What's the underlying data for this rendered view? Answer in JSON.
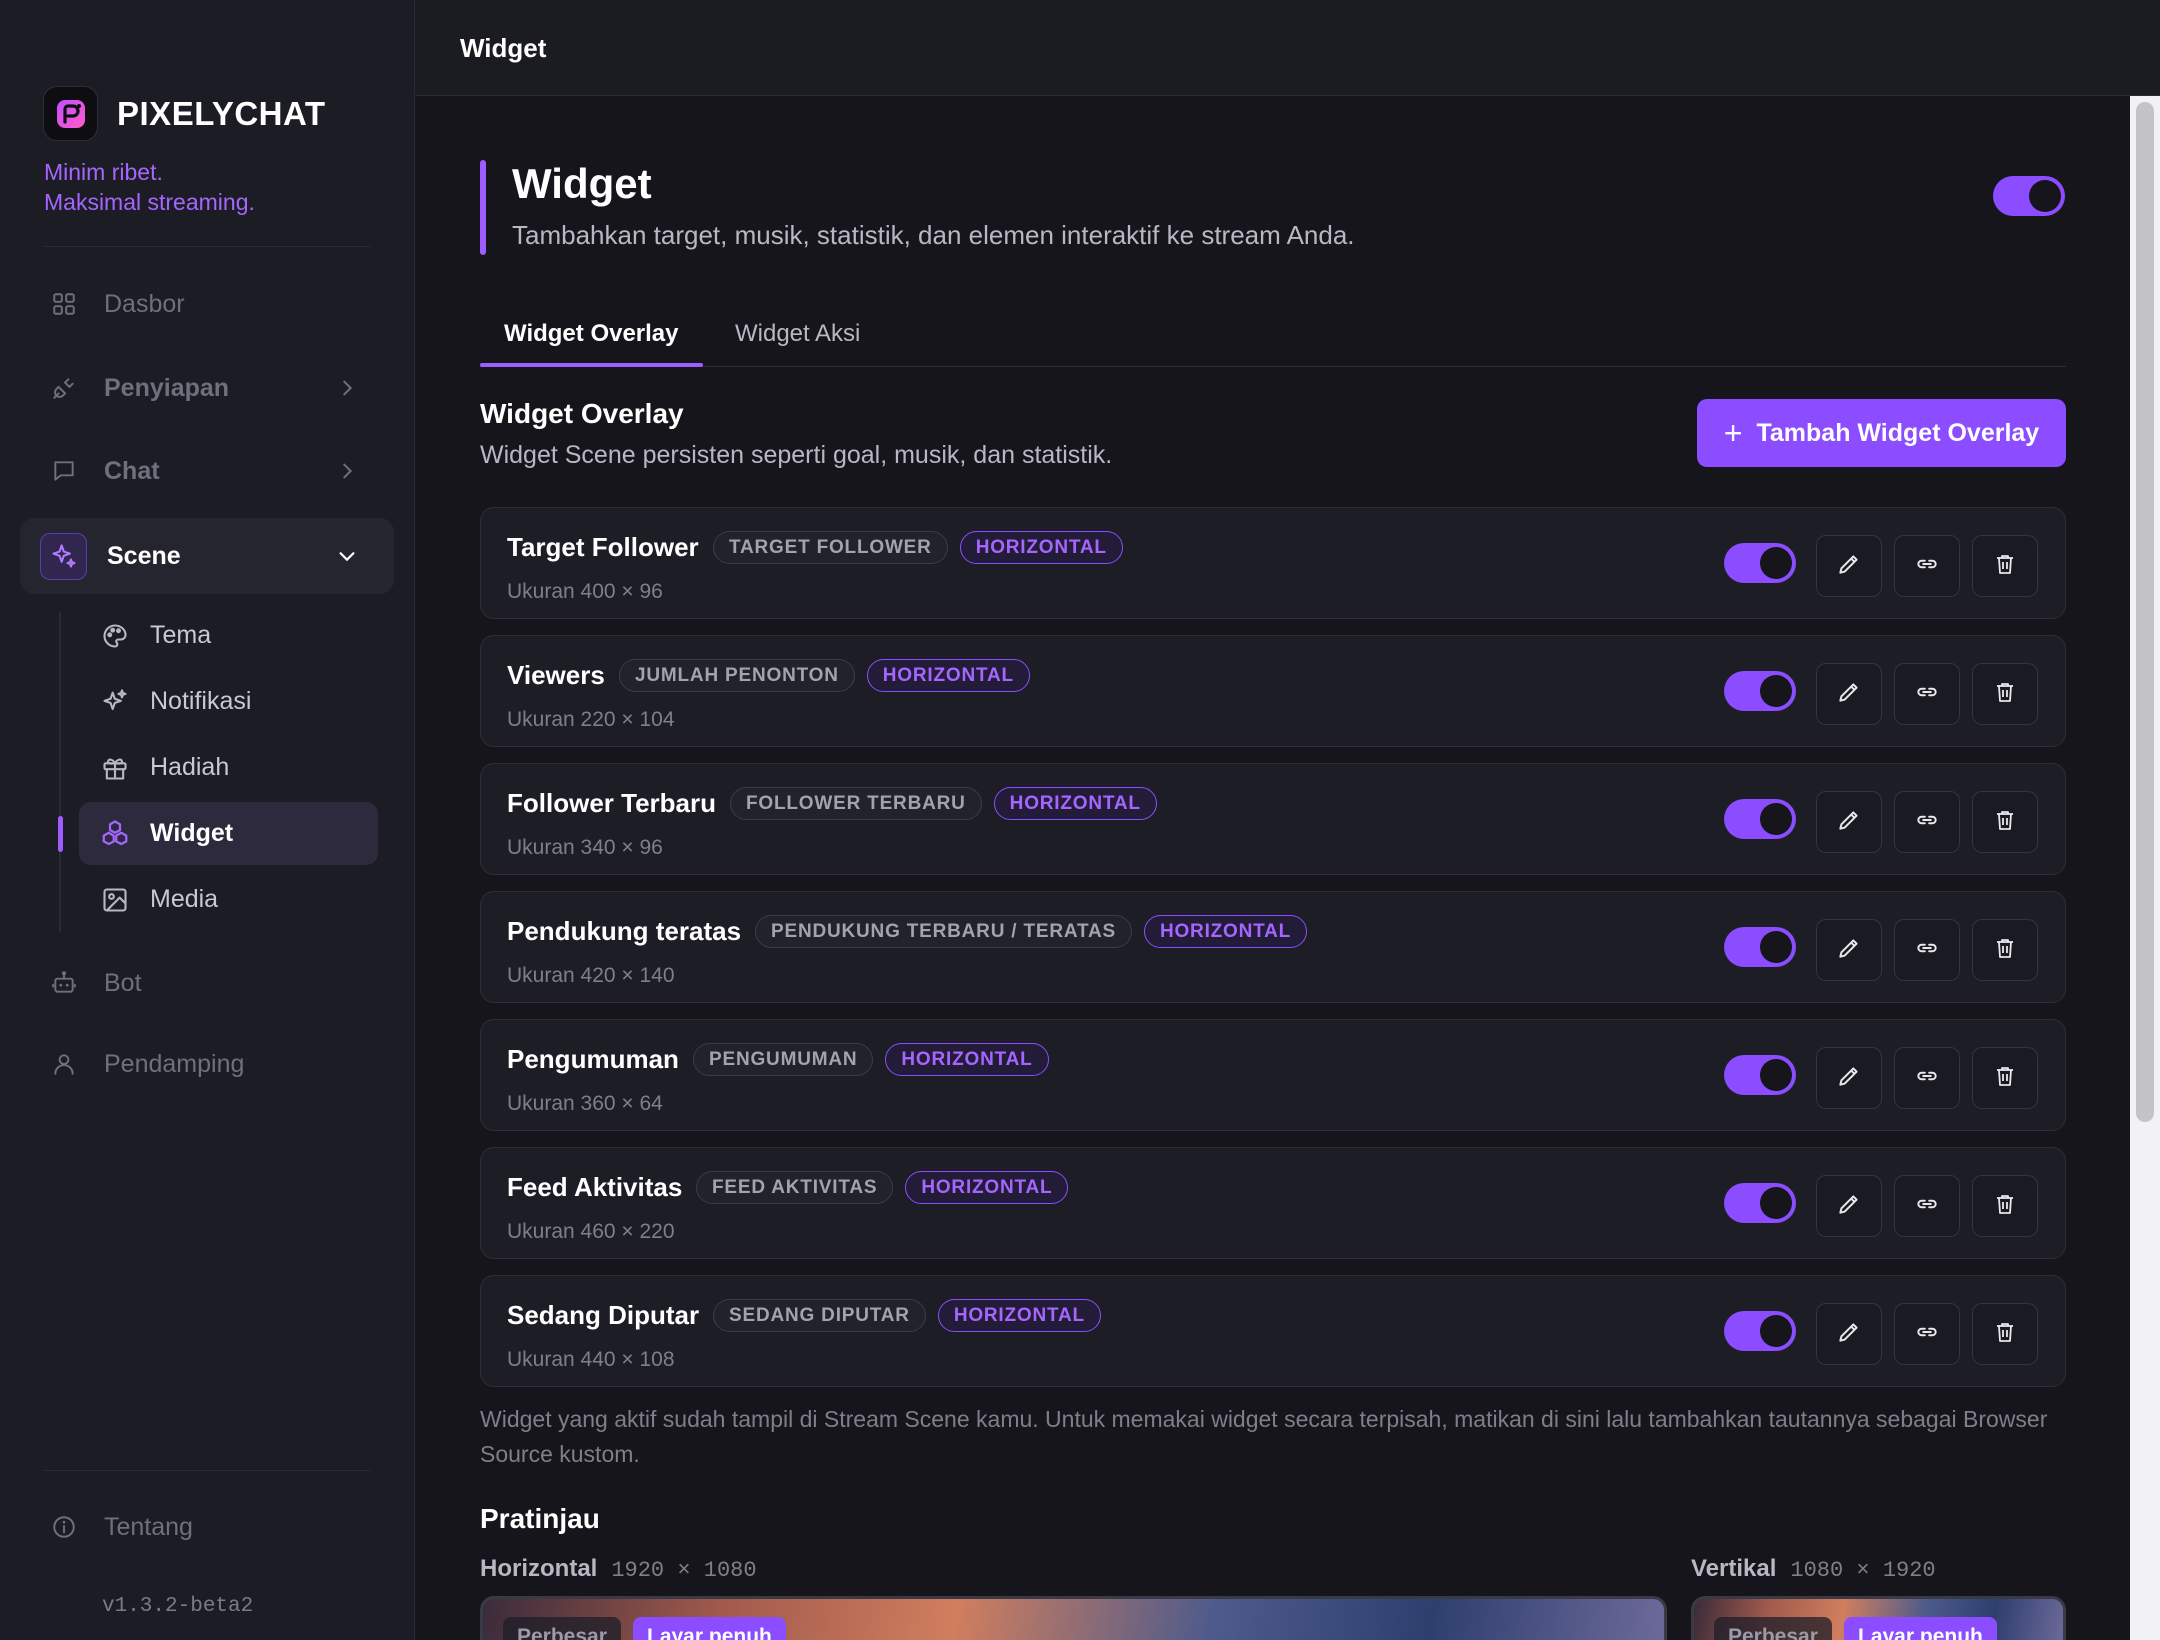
{
  "app": {
    "name": "PIXELYCHAT",
    "tagline_line1": "Minim ribet.",
    "tagline_line2": "Maksimal streaming.",
    "version": "v1.3.2-beta2"
  },
  "sidebar": {
    "nav": [
      {
        "label": "Dasbor",
        "icon": "grid-icon"
      },
      {
        "label": "Penyiapan",
        "icon": "plug-icon"
      },
      {
        "label": "Chat",
        "icon": "chat-bubble-icon"
      },
      {
        "label": "Scene",
        "icon": "sparkles-icon"
      },
      {
        "label": "Bot",
        "icon": "bot-icon"
      },
      {
        "label": "Pendamping",
        "icon": "user-icon"
      }
    ],
    "scene_children": [
      {
        "label": "Tema",
        "icon": "palette-icon"
      },
      {
        "label": "Notifikasi",
        "icon": "sparkles-icon"
      },
      {
        "label": "Hadiah",
        "icon": "gift-icon"
      },
      {
        "label": "Widget",
        "icon": "widget-cubes-icon"
      },
      {
        "label": "Media",
        "icon": "image-icon"
      }
    ],
    "about": {
      "label": "Tentang",
      "icon": "info-icon"
    }
  },
  "topbar": {
    "title": "Widget"
  },
  "page": {
    "title": "Widget",
    "subtitle": "Tambahkan target, musik, statistik, dan elemen interaktif ke stream Anda.",
    "enabled": true
  },
  "tabs": [
    {
      "label": "Widget Overlay",
      "active": true
    },
    {
      "label": "Widget Aksi",
      "active": false
    }
  ],
  "overlay": {
    "title": "Widget Overlay",
    "subtitle": "Widget Scene persisten seperti goal, musik, dan statistik.",
    "add_button": "Tambah Widget Overlay",
    "widgets": [
      {
        "name": "Target Follower",
        "type": "TARGET FOLLOWER",
        "orientation": "HORIZONTAL",
        "size": "Ukuran 400 × 96",
        "enabled": true
      },
      {
        "name": "Viewers",
        "type": "JUMLAH PENONTON",
        "orientation": "HORIZONTAL",
        "size": "Ukuran 220 × 104",
        "enabled": true
      },
      {
        "name": "Follower Terbaru",
        "type": "FOLLOWER TERBARU",
        "orientation": "HORIZONTAL",
        "size": "Ukuran 340 × 96",
        "enabled": true
      },
      {
        "name": "Pendukung teratas",
        "type": "PENDUKUNG TERBARU / TERATAS",
        "orientation": "HORIZONTAL",
        "size": "Ukuran 420 × 140",
        "enabled": true
      },
      {
        "name": "Pengumuman",
        "type": "PENGUMUMAN",
        "orientation": "HORIZONTAL",
        "size": "Ukuran 360 × 64",
        "enabled": true
      },
      {
        "name": "Feed Aktivitas",
        "type": "FEED AKTIVITAS",
        "orientation": "HORIZONTAL",
        "size": "Ukuran 460 × 220",
        "enabled": true
      },
      {
        "name": "Sedang Diputar",
        "type": "SEDANG DIPUTAR",
        "orientation": "HORIZONTAL",
        "size": "Ukuran 440 × 108",
        "enabled": true
      }
    ],
    "note": "Widget yang aktif sudah tampil di Stream Scene kamu. Untuk memakai widget secara terpisah, matikan di sini lalu tambahkan tautannya sebagai Browser Source kustom."
  },
  "preview": {
    "title": "Pratinjau",
    "horizontal": {
      "label": "Horizontal",
      "dims": "1920 × 1080"
    },
    "vertical": {
      "label": "Vertikal",
      "dims": "1080 × 1920"
    },
    "zoom_label": "Perbesar",
    "fullscreen_label": "Layar penuh"
  },
  "colors": {
    "accent": "#8b4dff",
    "accent_text": "#a566ff",
    "background": "#15151b",
    "sidebar": "#1c1c24"
  }
}
